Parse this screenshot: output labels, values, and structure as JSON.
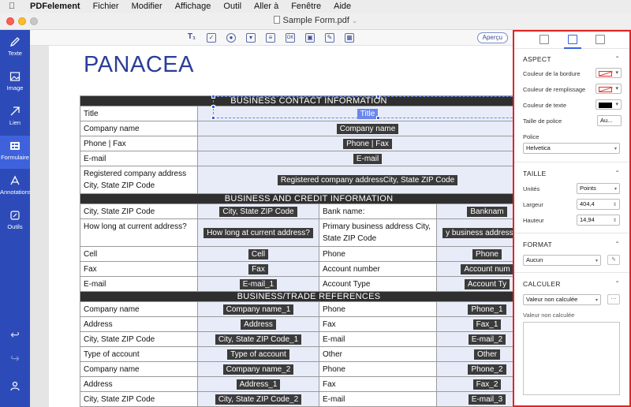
{
  "menubar": {
    "app_name": "PDFelement",
    "items": [
      "Fichier",
      "Modifier",
      "Affichage",
      "Outil",
      "Aller à",
      "Fenêtre",
      "Aide"
    ]
  },
  "window": {
    "title": "Sample Form.pdf"
  },
  "sidebar": {
    "items": [
      {
        "label": "Texte",
        "icon": "text-edit-icon"
      },
      {
        "label": "Image",
        "icon": "image-icon"
      },
      {
        "label": "Lien",
        "icon": "link-icon"
      },
      {
        "label": "Formulaire",
        "icon": "form-icon",
        "active": true
      },
      {
        "label": "Annotations",
        "icon": "annotation-icon"
      },
      {
        "label": "Outils",
        "icon": "tools-icon"
      }
    ]
  },
  "toolbar": {
    "tools": [
      "text-field-icon",
      "checkbox-icon",
      "radio-icon",
      "combo-box-icon",
      "list-box-icon",
      "button-icon",
      "image-field-icon",
      "signature-icon",
      "align-icon"
    ],
    "preview_label": "Aperçu"
  },
  "document": {
    "heading": "PANACEA",
    "sections": {
      "contact": "BUSINESS CONTACT INFORMATION",
      "credit": "BUSINESS AND CREDIT INFORMATION",
      "trade": "BUSINESS/TRADE REFERENCES"
    },
    "contact_rows": [
      {
        "label": "Title",
        "field": "Title"
      },
      {
        "label": "Company name",
        "field": "Company name"
      },
      {
        "label": "Phone | Fax",
        "field": "Phone | Fax"
      },
      {
        "label": "E-mail",
        "field": "E-mail"
      },
      {
        "label": "Registered company address City, State ZIP Code",
        "field": "Registered company addressCity, State ZIP Code"
      }
    ],
    "credit_rows": [
      {
        "label": "City, State ZIP Code",
        "field": "City, State ZIP Code",
        "label2": "Bank name:",
        "field2": "Banknam"
      },
      {
        "label": "How long at current address?",
        "field": "How long at current address?",
        "label2": "Primary business address City, State ZIP Code",
        "field2": "y business addressCity,"
      },
      {
        "label": "Cell",
        "field": "Cell",
        "label2": "Phone",
        "field2": "Phone"
      },
      {
        "label": "Fax",
        "field": "Fax",
        "label2": "Account number",
        "field2": "Account num"
      },
      {
        "label": "E-mail",
        "field": "E-mail_1",
        "label2": "Account Type",
        "field2": "Account Ty"
      }
    ],
    "trade_rows": [
      {
        "label": "Company name",
        "field": "Company name_1",
        "label2": "Phone",
        "field2": "Phone_1"
      },
      {
        "label": "Address",
        "field": "Address",
        "label2": "Fax",
        "field2": "Fax_1"
      },
      {
        "label": "City, State ZIP Code",
        "field": "City, State ZIP Code_1",
        "label2": "E-mail",
        "field2": "E-mail_2"
      },
      {
        "label": "Type of account",
        "field": "Type of account",
        "label2": "Other",
        "field2": "Other"
      },
      {
        "label": "Company name",
        "field": "Company name_2",
        "label2": "Phone",
        "field2": "Phone_2"
      },
      {
        "label": "Address",
        "field": "Address_1",
        "label2": "Fax",
        "field2": "Fax_2"
      },
      {
        "label": "City, State ZIP Code",
        "field": "City, State ZIP Code_2",
        "label2": "E-mail",
        "field2": "E-mail_3"
      }
    ]
  },
  "properties": {
    "aspect": {
      "title": "ASPECT",
      "border_color_label": "Couleur de la bordure",
      "fill_color_label": "Couleur de remplissage",
      "text_color_label": "Couleur de texte",
      "font_size_label": "Taille de police",
      "font_size_value": "Au...",
      "font_label": "Police",
      "font_value": "Helvetica"
    },
    "size": {
      "title": "TAILLE",
      "units_label": "Unités",
      "units_value": "Points",
      "width_label": "Largeur",
      "width_value": "404,4",
      "height_label": "Hauteur",
      "height_value": "14,94"
    },
    "format": {
      "title": "FORMAT",
      "value": "Aucun"
    },
    "calc": {
      "title": "CALCULER",
      "value": "Valeur non calculée",
      "note": "Valeur non calculée"
    }
  },
  "colors": {
    "sidebar": "#2d4bb8",
    "accent": "#3a62e0",
    "panel_border": "#e02424",
    "field_fill": "#e8ecf9"
  }
}
